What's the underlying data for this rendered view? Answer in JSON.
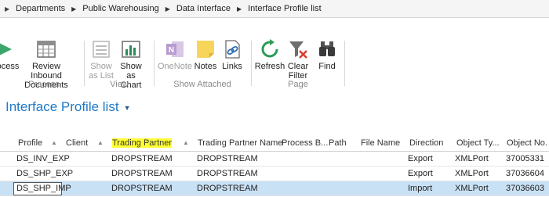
{
  "breadcrumb": [
    "Departments",
    "Public Warehousing",
    "Data Interface",
    "Interface Profile list"
  ],
  "ribbon": {
    "process_group": "Process",
    "view_group": "View",
    "attached_group": "Show Attached",
    "page_group": "Page",
    "process_btn": "ocess",
    "review_btn_1": "Review Inbound",
    "review_btn_2": "Documents",
    "show_as_list_1": "Show",
    "show_as_list_2": "as List",
    "show_as_chart_1": "Show as",
    "show_as_chart_2": "Chart",
    "onenote": "OneNote",
    "notes": "Notes",
    "links": "Links",
    "refresh": "Refresh",
    "clear_filter_1": "Clear",
    "clear_filter_2": "Filter",
    "find": "Find"
  },
  "page": {
    "title": "Interface Profile list"
  },
  "table": {
    "columns": [
      "Profile",
      "Client",
      "Trading Partner",
      "Trading Partner Name",
      "Process B...",
      "Path",
      "File Name",
      "Direction",
      "Object Ty...",
      "Object No."
    ],
    "rows": [
      [
        "DS_INV_EXP",
        "",
        "DROPSTREAM",
        "DROPSTREAM",
        "",
        "",
        "",
        "Export",
        "XMLPort",
        "37005331"
      ],
      [
        "DS_SHP_EXP",
        "",
        "DROPSTREAM",
        "DROPSTREAM",
        "",
        "",
        "",
        "Export",
        "XMLPort",
        "37036604"
      ],
      [
        "DS_SHP_IMP",
        "",
        "DROPSTREAM",
        "DROPSTREAM",
        "",
        "",
        "",
        "Import",
        "XMLPort",
        "37036603"
      ]
    ]
  }
}
